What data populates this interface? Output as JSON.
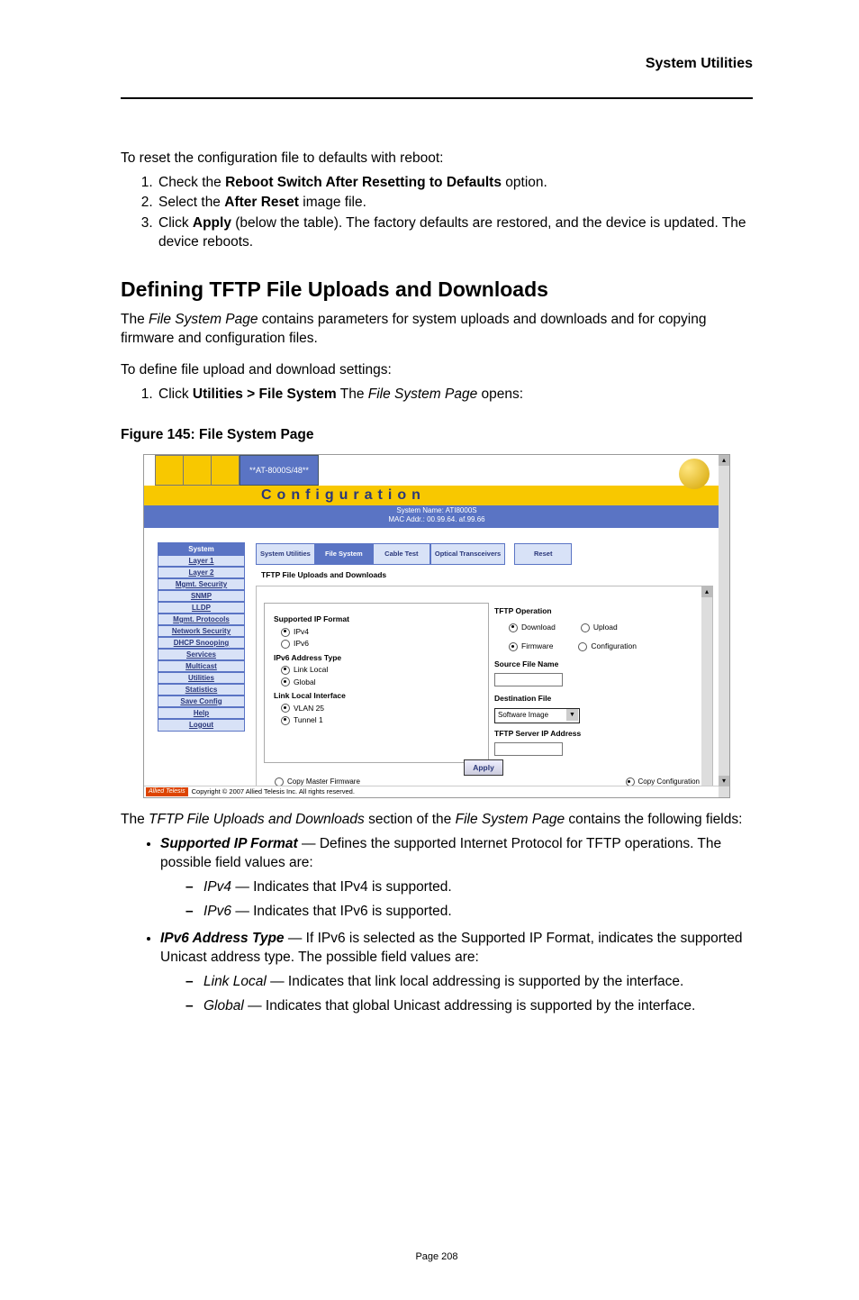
{
  "header": "System Utilities",
  "intro": "To reset the configuration file to defaults with reboot:",
  "steps": [
    {
      "pre": "Check the ",
      "b": "Reboot Switch After Resetting to Defaults",
      "post": " option."
    },
    {
      "pre": "Select the ",
      "b": "After Reset",
      "post": " image file."
    },
    {
      "pre": "Click ",
      "b": "Apply",
      "post": " (below the table). The factory defaults are restored, and the device is updated. The device reboots."
    }
  ],
  "h2": "Defining TFTP File Uploads and Downloads",
  "p1": {
    "pre": "The ",
    "i": "File System Page",
    "post": " contains parameters for system uploads and downloads and for copying firmware and configuration files."
  },
  "p2": "To define file upload and download settings:",
  "p2step": {
    "pre": "Click ",
    "b": "Utilities > File System",
    "mid": " The ",
    "i": "File System Page",
    "post": " opens:"
  },
  "figcap": "Figure 145: File System Page",
  "shot": {
    "pill": "**AT-8000S/48**",
    "conf": "Configuration",
    "sysname_lbl": "System Name:",
    "sysname_val": "ATI8000S",
    "mac_lbl": "MAC Addr.:",
    "mac_val": "00.99.64. af.99.66",
    "nav": [
      "System",
      "Layer 1",
      "Layer 2",
      "Mgmt. Security",
      "SNMP",
      "LLDP",
      "Mgmt. Protocols",
      "Network Security",
      "DHCP Snooping",
      "Services",
      "Multicast",
      "Utilities",
      "Statistics",
      "Save Config",
      "Help",
      "Logout"
    ],
    "tabs": [
      "System Utilities",
      "File System",
      "Cable Test",
      "Optical Transceivers",
      "Reset"
    ],
    "section": "TFTP File Uploads and Downloads",
    "card": {
      "l1": "Supported IP Format",
      "o1": "IPv4",
      "o2": "IPv6",
      "l2": "IPv6 Address Type",
      "o3": "Link Local",
      "o4": "Global",
      "l3": "Link Local Interface",
      "o5": "VLAN 25",
      "o6": "Tunnel 1"
    },
    "right": {
      "op": "TFTP Operation",
      "dl": "Download",
      "ul": "Upload",
      "fw": "Firmware",
      "cfg": "Configuration",
      "src": "Source File Name",
      "dst": "Destination File",
      "dstval": "Software Image",
      "srv": "TFTP Server IP Address"
    },
    "apply": "Apply",
    "bl": "Copy Master Firmware",
    "br": "Copy Configuration",
    "copyright": "Copyright © 2007 Allied Telesis Inc. All rights reserved.",
    "brand": "Allied Telesis"
  },
  "after": {
    "pre": "The ",
    "i": "TFTP File Uploads and Downloads",
    "mid": " section of the ",
    "i2": "File System Page",
    "post": " contains the following fields:"
  },
  "fields": [
    {
      "bi": "Supported IP Format",
      "desc": " — Defines the supported Internet Protocol for TFTP operations. The possible field values are:",
      "subs": [
        {
          "i": "IPv4",
          "d": " — Indicates that IPv4 is supported."
        },
        {
          "i": "IPv6",
          "d": " — Indicates that IPv6 is supported."
        }
      ]
    },
    {
      "bi": "IPv6 Address Type",
      "desc": " — If IPv6 is selected as the Supported IP Format, indicates the supported Unicast address type. The possible field values are:",
      "subs": [
        {
          "i": "Link Local",
          "d": " — Indicates that link local addressing is supported by the interface."
        },
        {
          "i": "Global",
          "d": " — Indicates that global Unicast addressing is supported by the interface."
        }
      ]
    }
  ],
  "pagenum": "Page 208"
}
